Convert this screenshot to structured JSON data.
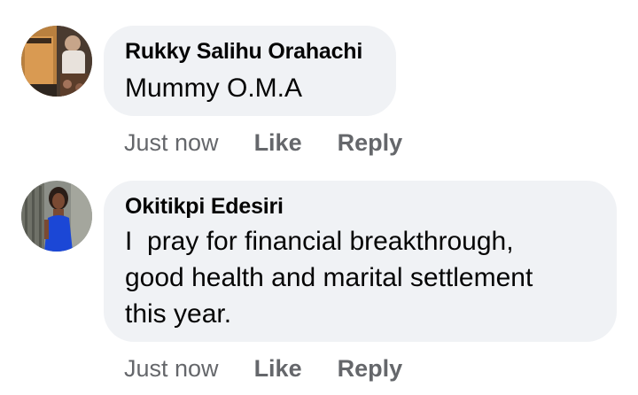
{
  "comments": [
    {
      "author": "Rukky Salihu Orahachi",
      "text": "Mummy O.M.A",
      "time": "Just now",
      "like_label": "Like",
      "reply_label": "Reply",
      "avatar_icon": "profile-photo-icon"
    },
    {
      "author": "Okitikpi Edesiri",
      "text_lines": [
        "I  pray for financial breakthrough,",
        "good health and marital settlement",
        "this year."
      ],
      "time": "Just now",
      "like_label": "Like",
      "reply_label": "Reply",
      "avatar_icon": "profile-photo-icon"
    }
  ],
  "colors": {
    "bubble": "#f0f2f5",
    "meta_text": "#65676b",
    "body_text": "#050505"
  }
}
